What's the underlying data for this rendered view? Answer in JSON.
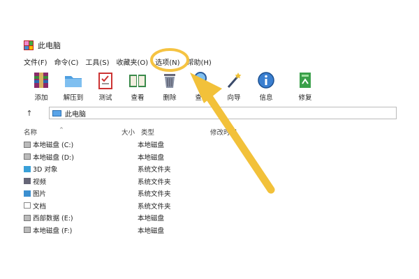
{
  "window": {
    "title": "此电脑"
  },
  "menu": [
    "文件(F)",
    "命令(C)",
    "工具(S)",
    "收藏夹(O)",
    "选项(N)",
    "帮助(H)"
  ],
  "toolbar": [
    {
      "label": "添加",
      "icon": "add-archive-icon"
    },
    {
      "label": "解压到",
      "icon": "extract-folder-icon"
    },
    {
      "label": "测试",
      "icon": "test-clipboard-icon"
    },
    {
      "label": "查看",
      "icon": "view-book-icon"
    },
    {
      "label": "删除",
      "icon": "trash-icon"
    },
    {
      "label": "查找",
      "icon": "find-magnifier-icon"
    },
    {
      "label": "向导",
      "icon": "wizard-wand-icon"
    },
    {
      "label": "信息",
      "icon": "info-icon"
    },
    {
      "label": "修复",
      "icon": "repair-icon"
    }
  ],
  "address": {
    "path": "此电脑"
  },
  "columns": {
    "name": "名称",
    "size": "大小",
    "type": "类型",
    "modified": "修改时间"
  },
  "rows": [
    {
      "name": "本地磁盘 (C:)",
      "type": "本地磁盘",
      "icon": "drive-icon"
    },
    {
      "name": "本地磁盘 (D:)",
      "type": "本地磁盘",
      "icon": "drive-icon"
    },
    {
      "name": "3D 对象",
      "type": "系统文件夹",
      "icon": "3d-objects-icon"
    },
    {
      "name": "视频",
      "type": "系统文件夹",
      "icon": "video-icon"
    },
    {
      "name": "图片",
      "type": "系统文件夹",
      "icon": "picture-icon"
    },
    {
      "name": "文档",
      "type": "系统文件夹",
      "icon": "document-icon"
    },
    {
      "name": "西部数据 (E:)",
      "type": "本地磁盘",
      "icon": "drive-icon"
    },
    {
      "name": "本地磁盘 (F:)",
      "type": "本地磁盘",
      "icon": "drive-icon"
    }
  ],
  "colors": {
    "highlight": "#f5c342",
    "arrow": "#f2c13a"
  }
}
